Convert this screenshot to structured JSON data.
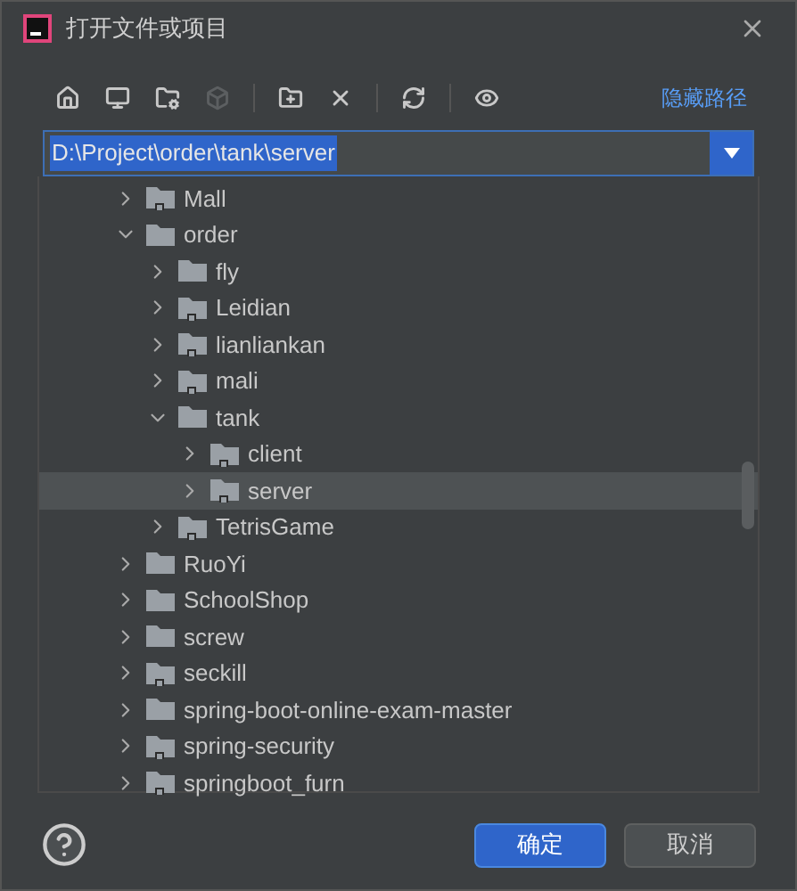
{
  "window": {
    "title": "打开文件或项目"
  },
  "toolbar": {
    "buttons": [
      {
        "kind": "home",
        "disabled": false
      },
      {
        "kind": "desktop",
        "disabled": false
      },
      {
        "kind": "project",
        "disabled": false
      },
      {
        "kind": "module",
        "disabled": true
      },
      {
        "kind": "separator"
      },
      {
        "kind": "new-folder",
        "disabled": false
      },
      {
        "kind": "delete",
        "disabled": false
      },
      {
        "kind": "separator"
      },
      {
        "kind": "refresh",
        "disabled": false
      },
      {
        "kind": "separator"
      },
      {
        "kind": "hidden",
        "disabled": false
      }
    ],
    "link": "隐藏路径"
  },
  "path_field": {
    "value": "D:\\Project\\order\\tank\\server"
  },
  "tree": [
    {
      "name": "Mall",
      "badge": true,
      "expanded": false,
      "selected": false
    },
    {
      "name": "order",
      "badge": false,
      "expanded": true,
      "selected": false,
      "children": [
        {
          "name": "fly",
          "badge": false,
          "expanded": false,
          "selected": false
        },
        {
          "name": "Leidian",
          "badge": true,
          "expanded": false,
          "selected": false
        },
        {
          "name": "lianliankan",
          "badge": true,
          "expanded": false,
          "selected": false
        },
        {
          "name": "mali",
          "badge": true,
          "expanded": false,
          "selected": false
        },
        {
          "name": "tank",
          "badge": false,
          "expanded": true,
          "selected": false,
          "children": [
            {
              "name": "client",
              "badge": true,
              "expanded": false,
              "selected": false
            },
            {
              "name": "server",
              "badge": true,
              "expanded": false,
              "selected": true
            }
          ]
        },
        {
          "name": "TetrisGame",
          "badge": true,
          "expanded": false,
          "selected": false
        }
      ]
    },
    {
      "name": "RuoYi",
      "badge": false,
      "expanded": false,
      "selected": false
    },
    {
      "name": "SchoolShop",
      "badge": false,
      "expanded": false,
      "selected": false
    },
    {
      "name": "screw",
      "badge": false,
      "expanded": false,
      "selected": false
    },
    {
      "name": "seckill",
      "badge": true,
      "expanded": false,
      "selected": false
    },
    {
      "name": "spring-boot-online-exam-master",
      "badge": false,
      "expanded": false,
      "selected": false
    },
    {
      "name": "spring-security",
      "badge": true,
      "expanded": false,
      "selected": false
    },
    {
      "name": "springboot_furn",
      "badge": true,
      "expanded": false,
      "selected": false
    }
  ],
  "buttons": [
    {
      "label": "确定",
      "kind": "primary"
    },
    {
      "label": "取消",
      "kind": "secondary"
    }
  ]
}
